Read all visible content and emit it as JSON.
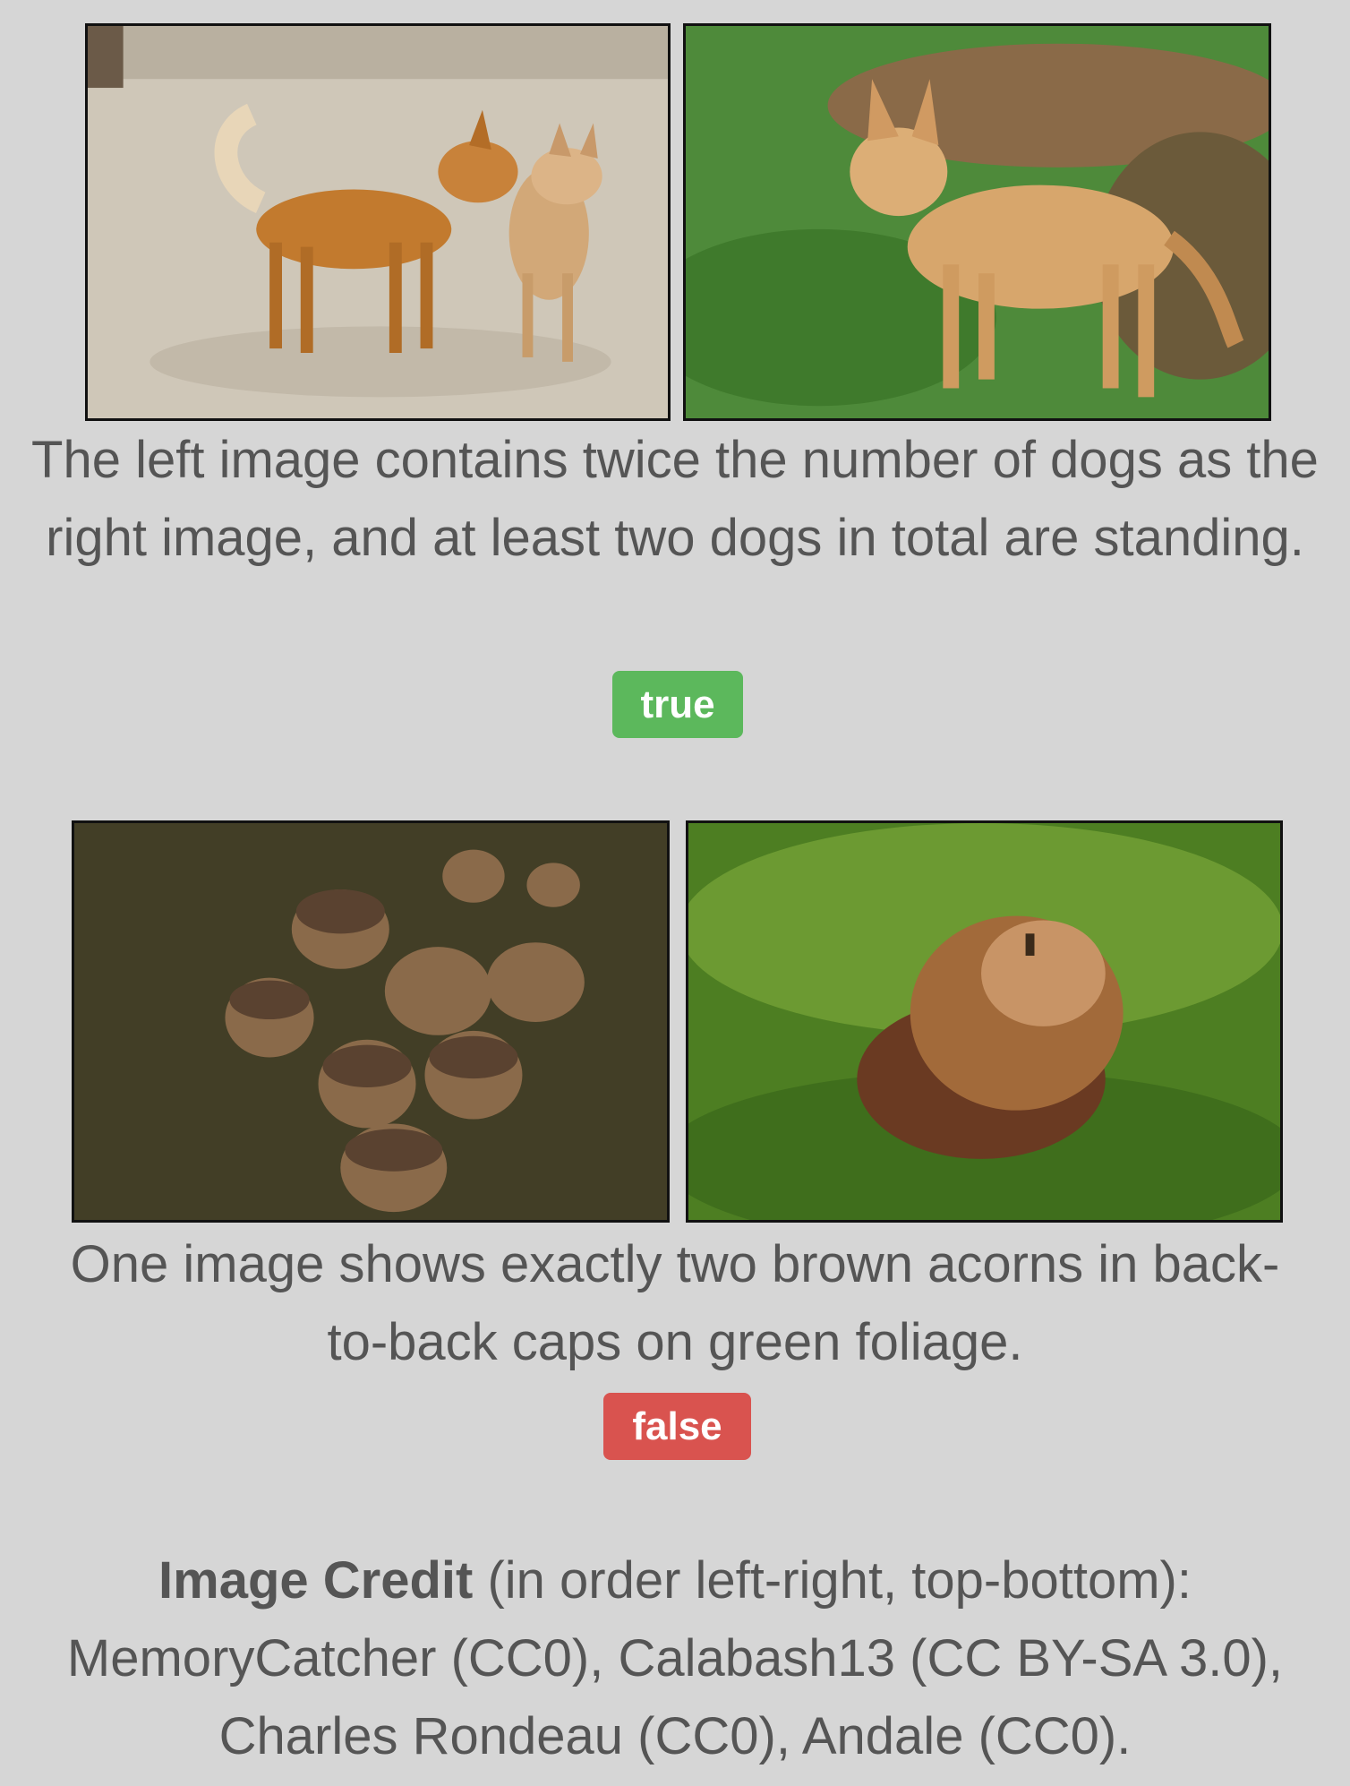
{
  "pairs": [
    {
      "caption": "The left image contains twice the number of dogs as the right image, and at least two dogs in total are standing.",
      "label": "true",
      "label_color": "#5cb85c"
    },
    {
      "caption": "One image shows exactly two brown acorns in back-to-back caps on green foliage.",
      "label": "false",
      "label_color": "#d9534f"
    }
  ],
  "credit": {
    "heading": "Image Credit",
    "order_note": " (in order left-right, top-bottom):",
    "text": "MemoryCatcher (CC0), Calabash13 (CC BY-SA 3.0), Charles Rondeau (CC0), Andale (CC0)."
  },
  "colors": {
    "background": "#d6d6d6",
    "text": "#555555",
    "true_badge": "#5cb85c",
    "false_badge": "#d9534f"
  }
}
